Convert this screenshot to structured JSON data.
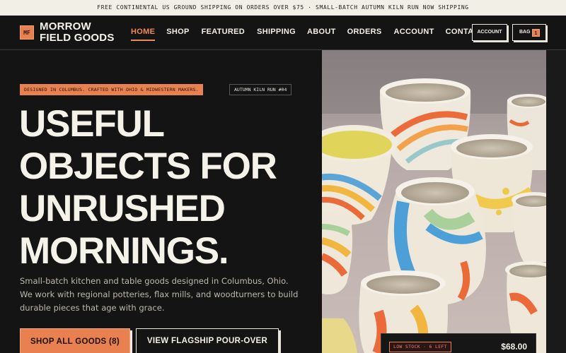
{
  "announcement": "FREE CONTINENTAL US GROUND SHIPPING ON ORDERS OVER $75 · SMALL-BATCH AUTUMN KILN RUN NOW SHIPPING",
  "brand": {
    "mark": "MF",
    "line1": "MORROW",
    "line2": "FIELD GOODS"
  },
  "nav": {
    "items": [
      {
        "label": "HOME",
        "active": true
      },
      {
        "label": "SHOP"
      },
      {
        "label": "FEATURED"
      },
      {
        "label": "SHIPPING"
      },
      {
        "label": "ABOUT"
      },
      {
        "label": "ORDERS"
      },
      {
        "label": "ACCOUNT"
      },
      {
        "label": "CONTACT"
      }
    ],
    "account_button": "ACCOUNT",
    "bag_button": "BAG",
    "bag_count": "1"
  },
  "hero": {
    "badge_primary": "DESIGNED IN COLUMBUS. CRAFTED WITH OHIO & MIDWESTERN MAKERS.",
    "badge_secondary": "AUTUMN KILN RUN #04",
    "headline": [
      "USEFUL",
      "OBJECTS FOR",
      "UNRUSHED",
      "MORNINGS."
    ],
    "subtext": "Small-batch kitchen and table goods designed in Columbus, Ohio. We work with regional potteries, flax mills, and woodturners to build durable pieces that age with grace.",
    "cta_primary": "SHOP ALL GOODS (8)",
    "cta_secondary": "VIEW FLAGSHIP POUR-OVER"
  },
  "product_card": {
    "stock": "LOW STOCK · 6 LEFT",
    "price": "$68.00"
  },
  "colors": {
    "accent": "#e8804f",
    "background": "#141414",
    "text": "#f3efe6"
  }
}
